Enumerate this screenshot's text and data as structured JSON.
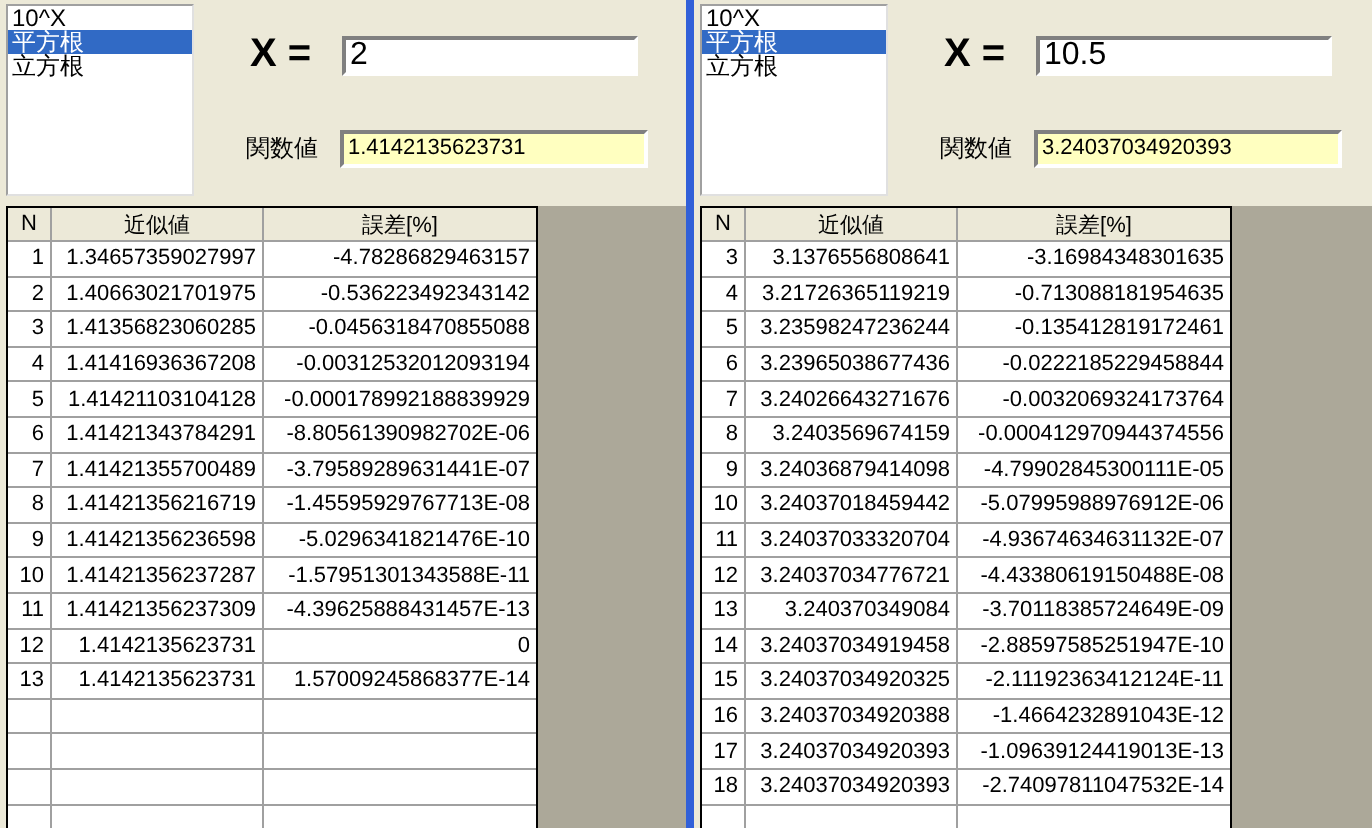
{
  "panels": [
    {
      "functions": [
        {
          "label": "10^X",
          "selected": false
        },
        {
          "label": "平方根",
          "selected": true
        },
        {
          "label": "立方根",
          "selected": false
        }
      ],
      "x_label": "X =",
      "x_value": "2",
      "result_label": "関数値",
      "result_value": "1.4142135623731",
      "table": {
        "columns": [
          "N",
          "近似値",
          "誤差[%]"
        ],
        "rows": [
          [
            "1",
            "1.34657359027997",
            "-4.78286829463157"
          ],
          [
            "2",
            "1.40663021701975",
            "-0.536223492343142"
          ],
          [
            "3",
            "1.41356823060285",
            "-0.0456318470855088"
          ],
          [
            "4",
            "1.41416936367208",
            "-0.00312532012093194"
          ],
          [
            "5",
            "1.41421103104128",
            "-0.000178992188839929"
          ],
          [
            "6",
            "1.41421343784291",
            "-8.80561390982702E-06"
          ],
          [
            "7",
            "1.41421355700489",
            "-3.79589289631441E-07"
          ],
          [
            "8",
            "1.41421356216719",
            "-1.45595929767713E-08"
          ],
          [
            "9",
            "1.41421356236598",
            "-5.0296341821476E-10"
          ],
          [
            "10",
            "1.41421356237287",
            "-1.57951301343588E-11"
          ],
          [
            "11",
            "1.41421356237309",
            "-4.39625888431457E-13"
          ],
          [
            "12",
            "1.4142135623731",
            "0"
          ],
          [
            "13",
            "1.4142135623731",
            "1.57009245868377E-14"
          ]
        ]
      }
    },
    {
      "functions": [
        {
          "label": "10^X",
          "selected": false
        },
        {
          "label": "平方根",
          "selected": true
        },
        {
          "label": "立方根",
          "selected": false
        }
      ],
      "x_label": "X =",
      "x_value": "10.5",
      "result_label": "関数値",
      "result_value": "3.24037034920393",
      "table": {
        "columns": [
          "N",
          "近似値",
          "誤差[%]"
        ],
        "rows": [
          [
            "3",
            "3.1376556808641",
            "-3.16984348301635"
          ],
          [
            "4",
            "3.21726365119219",
            "-0.713088181954635"
          ],
          [
            "5",
            "3.23598247236244",
            "-0.135412819172461"
          ],
          [
            "6",
            "3.23965038677436",
            "-0.0222185229458844"
          ],
          [
            "7",
            "3.24026643271676",
            "-0.0032069324173764"
          ],
          [
            "8",
            "3.2403569674159",
            "-0.000412970944374556"
          ],
          [
            "9",
            "3.24036879414098",
            "-4.79902845300111E-05"
          ],
          [
            "10",
            "3.24037018459442",
            "-5.07995988976912E-06"
          ],
          [
            "11",
            "3.24037033320704",
            "-4.93674634631132E-07"
          ],
          [
            "12",
            "3.24037034776721",
            "-4.43380619150488E-08"
          ],
          [
            "13",
            "3.240370349084",
            "-3.70118385724649E-09"
          ],
          [
            "14",
            "3.24037034919458",
            "-2.88597585251947E-10"
          ],
          [
            "15",
            "3.24037034920325",
            "-2.11192363412124E-11"
          ],
          [
            "16",
            "3.24037034920388",
            "-1.4664232891043E-12"
          ],
          [
            "17",
            "3.24037034920393",
            "-1.09639124419013E-13"
          ],
          [
            "18",
            "3.24037034920393",
            "-2.74097811047532E-14"
          ]
        ]
      }
    }
  ]
}
